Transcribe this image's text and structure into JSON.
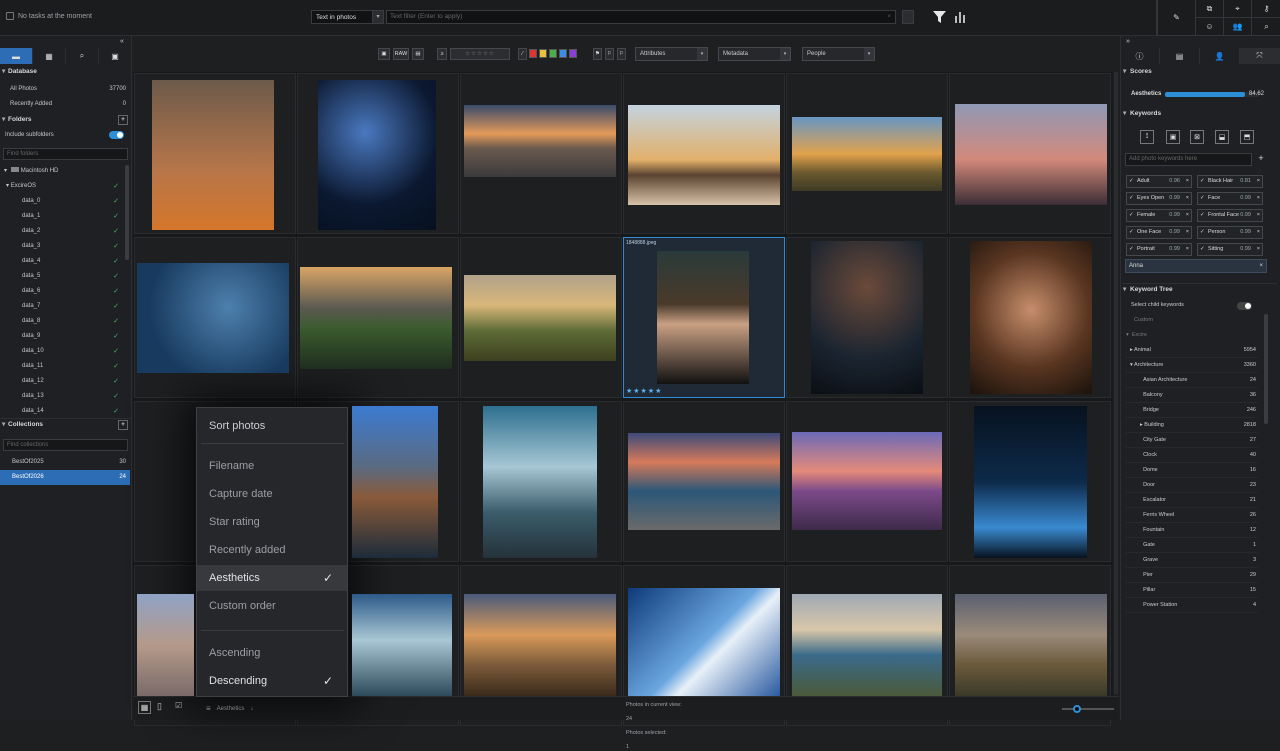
{
  "topbar": {
    "status": "No tasks at the moment",
    "search_type": "Text in photos",
    "search_placeholder": "Text filter (Enter to apply)"
  },
  "left_panel": {
    "database": {
      "title": "Database",
      "items": [
        {
          "label": "All Photos",
          "count": "37700"
        },
        {
          "label": "Recently Added",
          "count": "0"
        }
      ]
    },
    "folders": {
      "title": "Folders",
      "include_subfolders": "Include subfolders",
      "find_placeholder": "Find folders",
      "drive": "Macintosh HD",
      "root": "ExcireOS",
      "items": [
        "data_0",
        "data_1",
        "data_2",
        "data_3",
        "data_4",
        "data_5",
        "data_6",
        "data_7",
        "data_8",
        "data_9",
        "data_10",
        "data_11",
        "data_12",
        "data_13",
        "data_14"
      ]
    },
    "collections": {
      "title": "Collections",
      "find_placeholder": "Find collections",
      "items": [
        {
          "label": "BestOf2025",
          "count": "30"
        },
        {
          "label": "BestOf2026",
          "count": "24"
        }
      ]
    }
  },
  "toolbar": {
    "raw_label": "RAW",
    "attributes": "Attributes",
    "metadata": "Metadata",
    "people": "People",
    "color_labels": [
      "#e03434",
      "#e8c23c",
      "#4cb04a",
      "#3a8ee6",
      "#8a3ed8"
    ]
  },
  "grid": {
    "selected_filename": "1848888.jpeg",
    "selected_rating": 5
  },
  "sort_menu": {
    "title": "Sort photos",
    "fields": [
      "Filename",
      "Capture date",
      "Star rating",
      "Recently added",
      "Aesthetics",
      "Custom order"
    ],
    "selected_field": "Aesthetics",
    "orders": [
      "Ascending",
      "Descending"
    ],
    "selected_order": "Descending"
  },
  "bottombar": {
    "sort_label": "Aesthetics",
    "photos_in_view_label": "Photos in current view:",
    "photos_in_view": "24",
    "photos_selected_label": "Photos selected:",
    "photos_selected": "1"
  },
  "right_panel": {
    "scores": {
      "title": "Scores",
      "aesthetics_label": "Aesthetics",
      "aesthetics_value": "84.62",
      "aesthetics_fraction": 0.85
    },
    "keywords": {
      "title": "Keywords",
      "add_placeholder": "Add photo keywords here",
      "chips": [
        {
          "label": "Adult",
          "conf": "0.96"
        },
        {
          "label": "Black Hair",
          "conf": "0.81"
        },
        {
          "label": "Eyes Open",
          "conf": "0.99"
        },
        {
          "label": "Face",
          "conf": "0.99"
        },
        {
          "label": "Female",
          "conf": "0.99"
        },
        {
          "label": "Frontal Face",
          "conf": "0.99"
        },
        {
          "label": "One Face",
          "conf": "0.99"
        },
        {
          "label": "Person",
          "conf": "0.99"
        },
        {
          "label": "Portrait",
          "conf": "0.99"
        },
        {
          "label": "Sitting",
          "conf": "0.99"
        }
      ],
      "person": "Anna"
    },
    "keyword_tree": {
      "title": "Keyword Tree",
      "select_child": "Select child keywords",
      "custom": "Custom",
      "excire": "Excire",
      "items": [
        {
          "label": "Animal",
          "count": "5954"
        },
        {
          "label": "Architecture",
          "count": "3360"
        },
        {
          "label": "Asian Architecture",
          "count": "24"
        },
        {
          "label": "Balcony",
          "count": "36"
        },
        {
          "label": "Bridge",
          "count": "246"
        },
        {
          "label": "Building",
          "count": "2818"
        },
        {
          "label": "City Gate",
          "count": "27"
        },
        {
          "label": "Clock",
          "count": "40"
        },
        {
          "label": "Dome",
          "count": "16"
        },
        {
          "label": "Door",
          "count": "23"
        },
        {
          "label": "Escalator",
          "count": "21"
        },
        {
          "label": "Ferris Wheel",
          "count": "26"
        },
        {
          "label": "Fountain",
          "count": "12"
        },
        {
          "label": "Gate",
          "count": "1"
        },
        {
          "label": "Grave",
          "count": "3"
        },
        {
          "label": "Pier",
          "count": "29"
        },
        {
          "label": "Pillar",
          "count": "15"
        },
        {
          "label": "Power Station",
          "count": "4"
        }
      ]
    }
  }
}
